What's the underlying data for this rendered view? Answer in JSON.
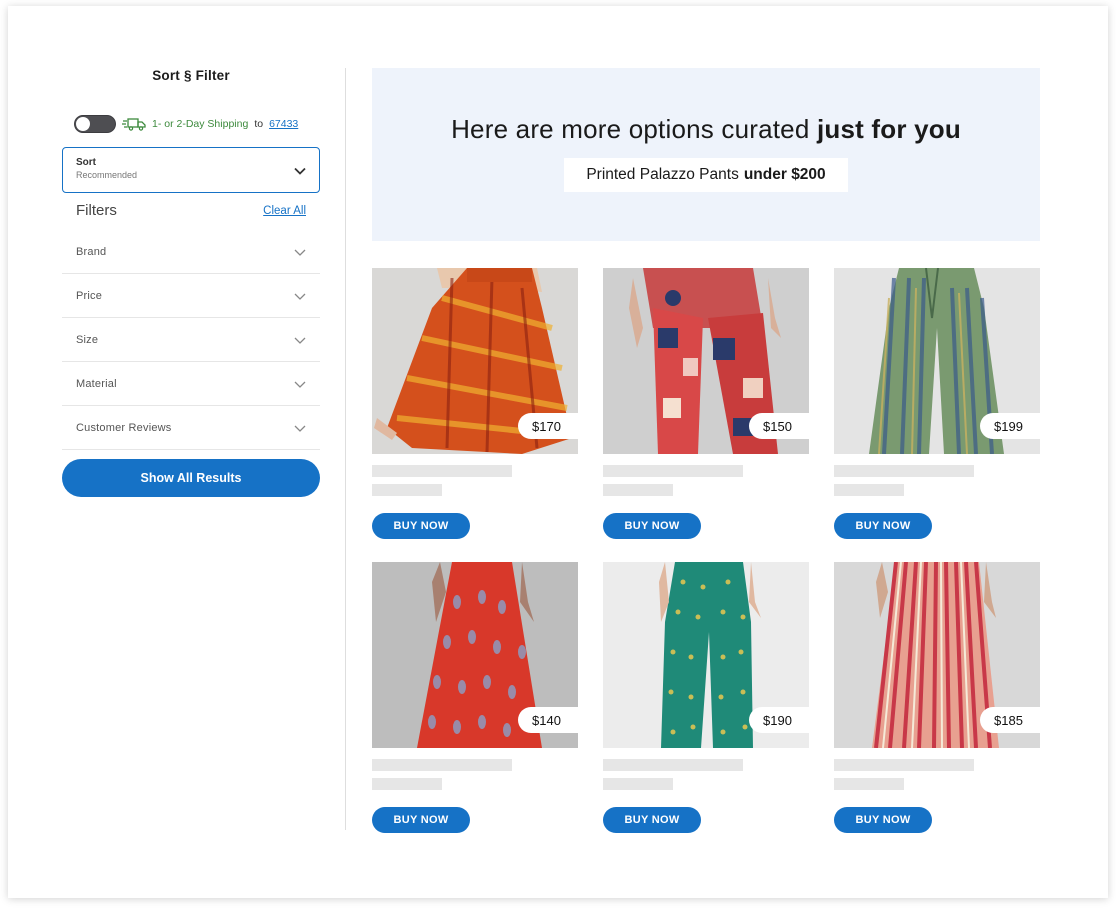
{
  "sidebar": {
    "title": "Sort § Filter",
    "shipping": {
      "text": "1- or 2-Day Shipping",
      "to": "to",
      "zip": "67433"
    },
    "sort": {
      "label": "Sort",
      "value": "Recommended"
    },
    "filters_title": "Filters",
    "clear_all": "Clear All",
    "filters": [
      {
        "label": "Brand"
      },
      {
        "label": "Price"
      },
      {
        "label": "Size"
      },
      {
        "label": "Material"
      },
      {
        "label": "Customer Reviews"
      }
    ],
    "show_all": "Show All Results"
  },
  "banner": {
    "title_prefix": "Here are more options curated",
    "title_bold": "just for you",
    "chip_prefix": "Printed Palazzo Pants",
    "chip_bold": "under $200"
  },
  "products": [
    {
      "price": "$170",
      "buy": "BUY NOW"
    },
    {
      "price": "$150",
      "buy": "BUY NOW"
    },
    {
      "price": "$199",
      "buy": "BUY NOW"
    },
    {
      "price": "$140",
      "buy": "BUY NOW"
    },
    {
      "price": "$190",
      "buy": "BUY NOW"
    },
    {
      "price": "$185",
      "buy": "BUY NOW"
    }
  ],
  "colors": {
    "accent": "#1672c6",
    "shipping_green": "#3d8a3d",
    "banner_bg": "#eef3fb",
    "skeleton": "#e6e6e6"
  },
  "icons": {
    "toggle": "toggle-switch-off",
    "truck": "fast-delivery-truck-icon",
    "chevron": "chevron-down-icon"
  }
}
